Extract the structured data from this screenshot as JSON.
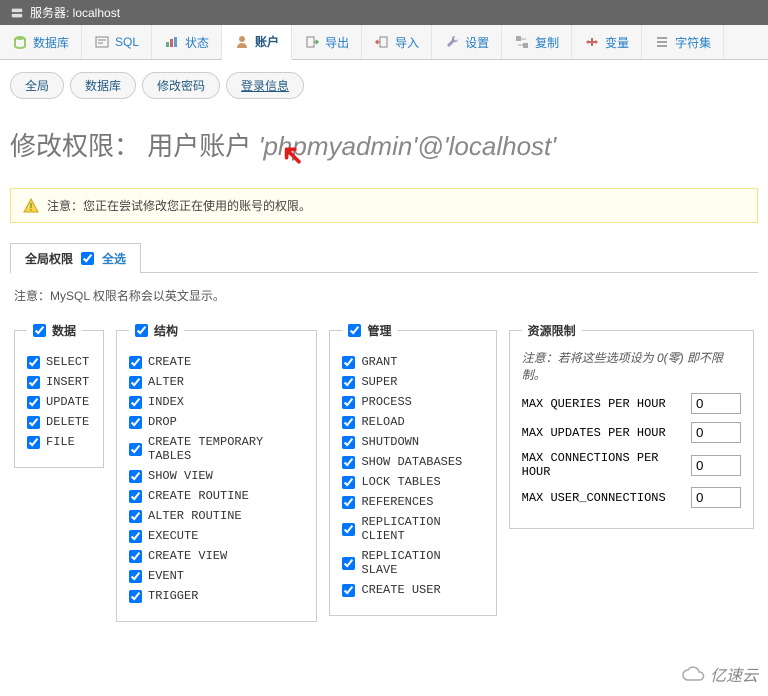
{
  "breadcrumb": {
    "label": "服务器: localhost"
  },
  "topnav": [
    {
      "label": "数据库"
    },
    {
      "label": "SQL"
    },
    {
      "label": "状态"
    },
    {
      "label": "账户"
    },
    {
      "label": "导出"
    },
    {
      "label": "导入"
    },
    {
      "label": "设置"
    },
    {
      "label": "复制"
    },
    {
      "label": "变量"
    },
    {
      "label": "字符集"
    }
  ],
  "subnav": [
    {
      "label": "全局"
    },
    {
      "label": "数据库"
    },
    {
      "label": "修改密码"
    },
    {
      "label": "登录信息"
    }
  ],
  "title": {
    "prefix": "修改权限：",
    "mid": "用户账户",
    "account": "'phpmyadmin'@'localhost'"
  },
  "notice": "注意：您正在尝试修改您正在使用的账号的权限。",
  "section": {
    "title": "全局权限",
    "selectAll": "全选"
  },
  "mysqlNote": "注意：MySQL 权限名称会以英文显示。",
  "groups": {
    "data": {
      "title": "数据",
      "items": [
        "SELECT",
        "INSERT",
        "UPDATE",
        "DELETE",
        "FILE"
      ]
    },
    "struct": {
      "title": "结构",
      "items": [
        "CREATE",
        "ALTER",
        "INDEX",
        "DROP",
        "CREATE TEMPORARY TABLES",
        "SHOW VIEW",
        "CREATE ROUTINE",
        "ALTER ROUTINE",
        "EXECUTE",
        "CREATE VIEW",
        "EVENT",
        "TRIGGER"
      ]
    },
    "admin": {
      "title": "管理",
      "items": [
        "GRANT",
        "SUPER",
        "PROCESS",
        "RELOAD",
        "SHUTDOWN",
        "SHOW DATABASES",
        "LOCK TABLES",
        "REFERENCES",
        "REPLICATION CLIENT",
        "REPLICATION SLAVE",
        "CREATE USER"
      ]
    }
  },
  "resource": {
    "title": "资源限制",
    "note": "注意：若将这些选项设为 0(零) 即不限制。",
    "rows": [
      {
        "label": "MAX QUERIES PER HOUR",
        "value": "0"
      },
      {
        "label": "MAX UPDATES PER HOUR",
        "value": "0"
      },
      {
        "label": "MAX CONNECTIONS PER HOUR",
        "value": "0"
      },
      {
        "label": "MAX USER_CONNECTIONS",
        "value": "0"
      }
    ]
  },
  "watermark": "亿速云"
}
